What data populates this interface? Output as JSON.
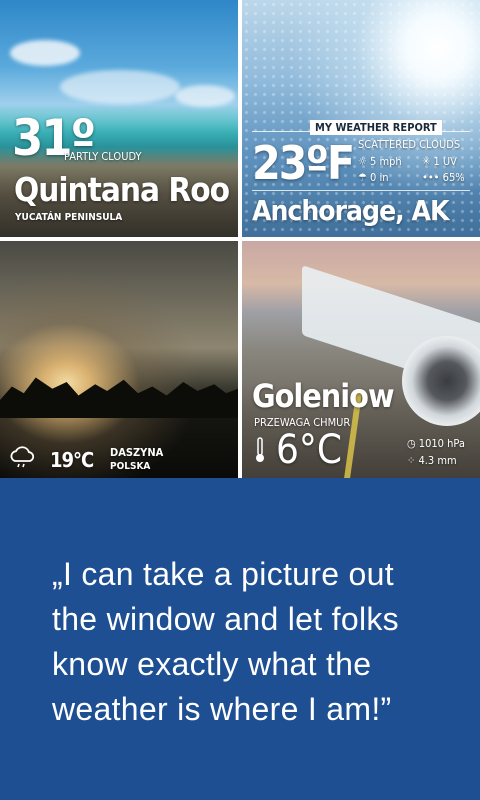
{
  "tiles": {
    "quintana": {
      "temp": "31º",
      "condition": "PARTLY CLOUDY",
      "city": "Quintana Roo",
      "region": "YUCATÁN PENINSULA"
    },
    "anchorage": {
      "header": "MY WEATHER REPORT",
      "temp": "23ºF",
      "condition": "SCATTERED CLOUDS",
      "wind": "5 mph",
      "uv": "1 UV",
      "precip": "0 in",
      "humidity": "65%",
      "city": "Anchorage, AK"
    },
    "daszyna": {
      "temp": "19°C",
      "city": "DASZYNA",
      "country": "POLSKA"
    },
    "goleniow": {
      "city": "Goleniow",
      "condition": "PRZEWAGA CHMUR",
      "temp": "6°C",
      "pressure": "1010 hPa",
      "rain": "4.3 mm"
    }
  },
  "quote": {
    "line1": "„I can take a picture out",
    "line2": "the window and let folks",
    "line3": "know exactly what the",
    "line4": "weather is where I am!”"
  },
  "colors": {
    "background": "#1e4f93",
    "text": "#ffffff"
  }
}
